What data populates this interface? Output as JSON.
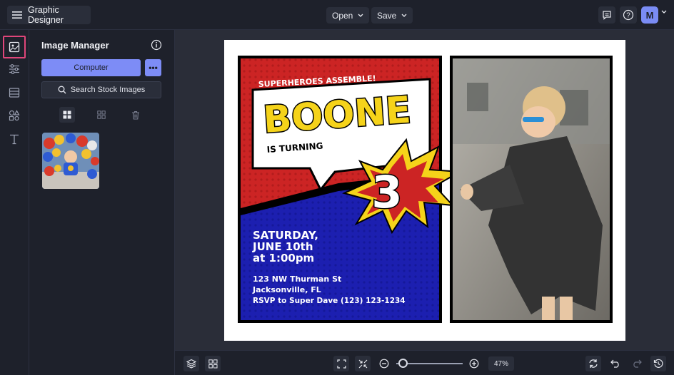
{
  "app": {
    "title": "Graphic Designer",
    "avatar_initial": "M"
  },
  "toolbar": {
    "open_label": "Open",
    "save_label": "Save"
  },
  "panel": {
    "title": "Image Manager",
    "computer_button": "Computer",
    "more_button": "•••",
    "stock_button": "Search Stock Images"
  },
  "design": {
    "headline": "SUPERHEROES ASSEMBLE!",
    "name": "BOONE",
    "subhead": "IS TURNING",
    "age": "3",
    "date_line1": "SATURDAY,",
    "date_line2": "JUNE 10th",
    "date_line3": "at 1:00pm",
    "address1": "123 NW Thurman St",
    "address2": "Jacksonville, FL",
    "rsvp": "RSVP to Super Dave (123) 123-1234"
  },
  "zoom": {
    "value": "47%",
    "level": 0.1
  },
  "colors": {
    "accent": "#7d8cf6",
    "active_outline": "#e0467a",
    "bg": "#1e212b",
    "canvas": "#2a2d38",
    "comic_red": "#cc2424",
    "comic_blue": "#1c1fb0",
    "comic_yellow": "#f5d31a"
  },
  "icons": [
    "menu-icon",
    "chevron-down-icon",
    "comment-icon",
    "help-icon",
    "image-icon",
    "sliders-icon",
    "layout-icon",
    "shapes-icon",
    "text-icon",
    "info-icon",
    "search-icon",
    "grid-large-icon",
    "grid-small-icon",
    "trash-icon",
    "layers-icon",
    "grid-icon",
    "fit-screen-icon",
    "shrink-icon",
    "zoom-out-icon",
    "zoom-in-icon",
    "refresh-icon",
    "undo-icon",
    "redo-icon",
    "history-icon"
  ]
}
